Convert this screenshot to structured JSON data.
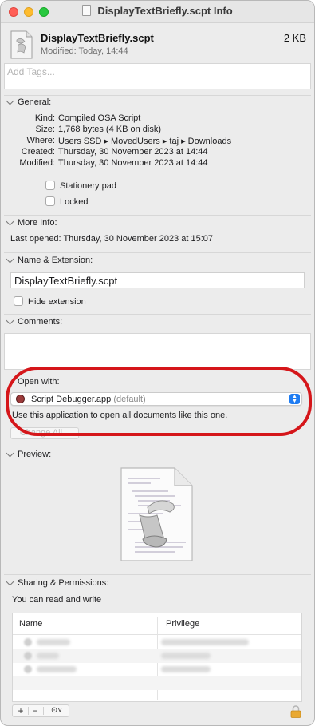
{
  "window": {
    "title": "DisplayTextBriefly.scpt Info"
  },
  "header": {
    "file_name": "DisplayTextBriefly.scpt",
    "file_size": "2 KB",
    "modified": "Modified: Today, 14:44"
  },
  "tags": {
    "placeholder": "Add Tags..."
  },
  "general": {
    "heading": "General:",
    "rows": [
      {
        "key": "Kind:",
        "value": "Compiled OSA Script"
      },
      {
        "key": "Size:",
        "value": "1,768 bytes (4 KB on disk)"
      },
      {
        "key": "Where:",
        "value": "Users SSD ▸ MovedUsers ▸ taj ▸ Downloads"
      },
      {
        "key": "Created:",
        "value": "Thursday, 30 November 2023 at 14:44"
      },
      {
        "key": "Modified:",
        "value": "Thursday, 30 November 2023 at 14:44"
      }
    ],
    "stationery_label": "Stationery pad",
    "stationery_checked": false,
    "locked_label": "Locked",
    "locked_checked": false
  },
  "more_info": {
    "heading": "More Info:",
    "last_opened": "Last opened: Thursday, 30 November 2023 at 15:07"
  },
  "name_extension": {
    "heading": "Name & Extension:",
    "value": "DisplayTextBriefly.scpt",
    "hide_extension_label": "Hide extension",
    "hide_extension_checked": false
  },
  "comments": {
    "heading": "Comments:"
  },
  "open_with": {
    "heading": "Open with:",
    "app": "Script Debugger.app",
    "default_suffix": "(default)",
    "description": "Use this application to open all documents like this one.",
    "change_all": "Change All..."
  },
  "preview": {
    "heading": "Preview:"
  },
  "sharing": {
    "heading": "Sharing & Permissions:",
    "status": "You can read and write",
    "col_name": "Name",
    "col_privilege": "Privilege",
    "add_symbol": "+",
    "remove_symbol": "−",
    "action_symbol": "⊙˅"
  },
  "colors": {
    "highlight": "#d5161a",
    "accent": "#1e7cf2"
  }
}
